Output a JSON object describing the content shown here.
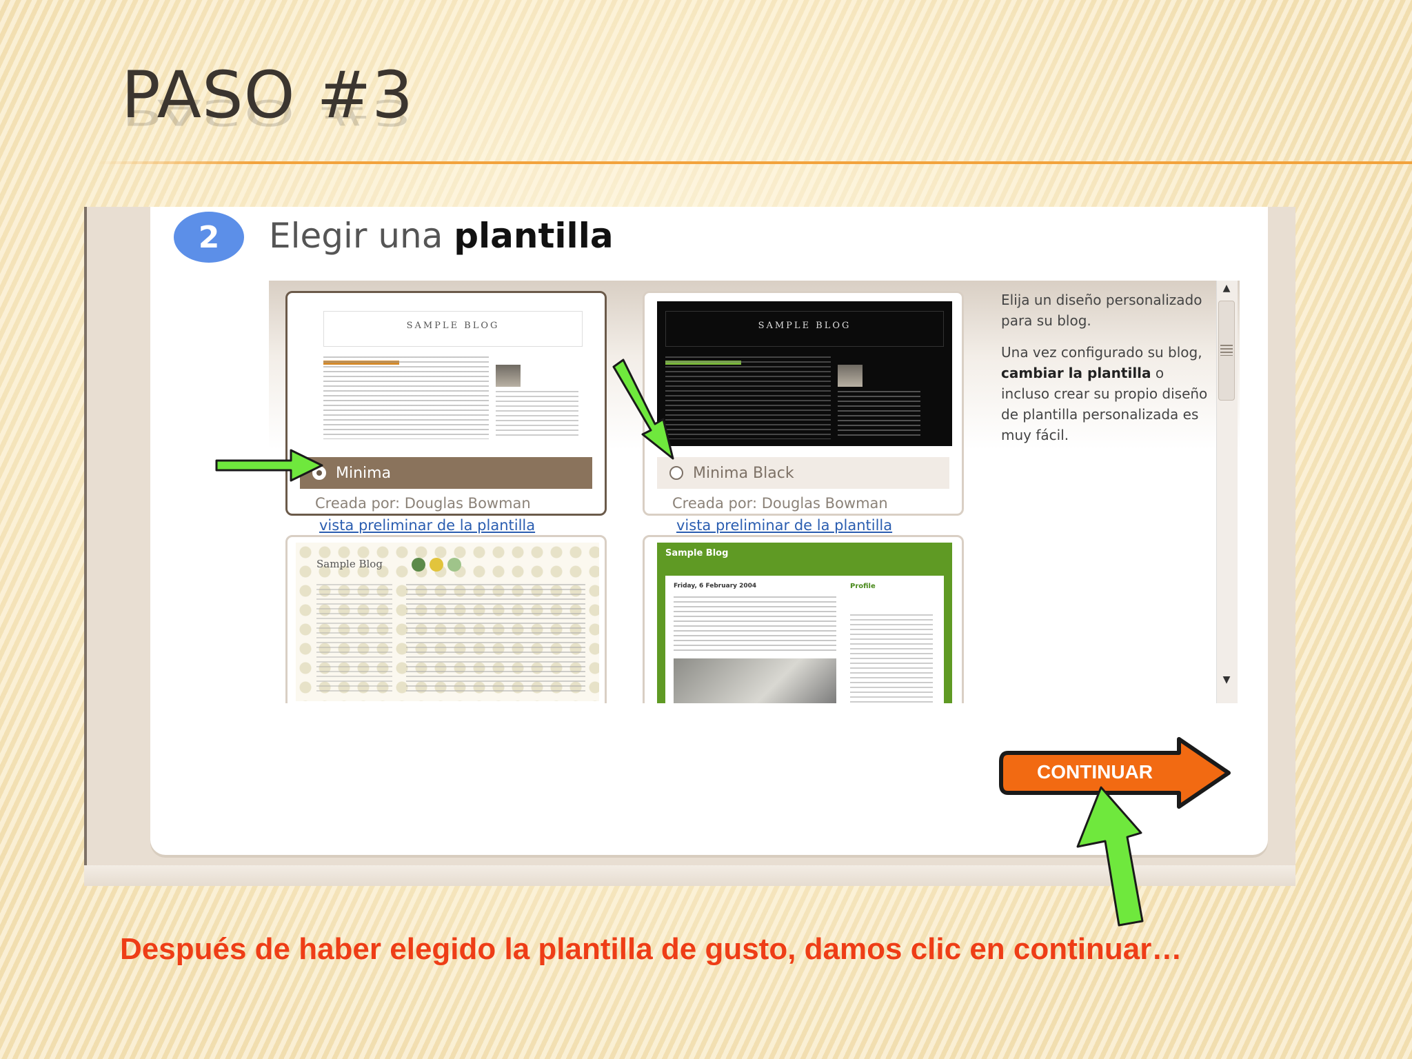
{
  "slide": {
    "title": "PASO #3",
    "caption": "Después de haber elegido la plantilla de gusto, damos clic en continuar…"
  },
  "step": {
    "number": "2",
    "heading_prefix": "Elegir una ",
    "heading_bold": "plantilla"
  },
  "templates": [
    {
      "name": "Minima",
      "author": "Creada por: Douglas Bowman",
      "preview_link": "vista preliminar de la plantilla",
      "thumb_title": "SAMPLE BLOG",
      "selected": true
    },
    {
      "name": "Minima Black",
      "author": "Creada por: Douglas Bowman",
      "preview_link": "vista preliminar de la plantilla",
      "thumb_title": "SAMPLE BLOG",
      "selected": false
    },
    {
      "thumb_title": "Sample Blog"
    },
    {
      "thumb_title": "Sample Blog",
      "thumb_date": "Friday, 6 February 2004",
      "thumb_sidebar_heading": "Profile"
    }
  ],
  "description": {
    "p1": "Elija un diseño personalizado para su blog.",
    "p2_start": "Una vez configurado su blog, ",
    "p2_bold": "cambiar la plantilla",
    "p2_end": " o incluso crear su propio diseño de plantilla personalizada es muy fácil."
  },
  "continue_button": {
    "label": "CONTINUAR",
    "color": "#f26a12"
  },
  "colors": {
    "accent_rule": "#f2a23c",
    "caption": "#ee3d16",
    "annotation_arrow": "#6fe83d",
    "badge": "#5c8fe8",
    "selected_bar": "#8a735c"
  },
  "icons": {
    "scroll_up": "▲",
    "scroll_down": "▼"
  }
}
